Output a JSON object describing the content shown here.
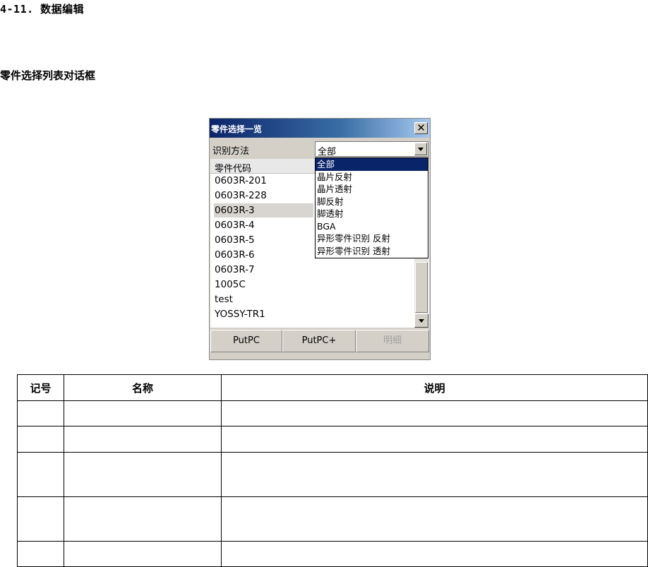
{
  "doc": {
    "heading": "4-11. 数据编辑",
    "subheading": "零件选择列表对话框"
  },
  "dialog": {
    "title": "零件选择一览",
    "close_glyph": "✕",
    "method_label": "识别方法",
    "method_selected": "全部",
    "list_header": "零件代码",
    "parts": [
      "0603R-201",
      "0603R-228",
      "0603R-3",
      "0603R-4",
      "0603R-5",
      "0603R-6",
      "0603R-7",
      "1005C",
      "test",
      "YOSSY-TR1"
    ],
    "selected_part": "0603R-3",
    "method_options": [
      "全部",
      "晶片反射",
      "晶片透射",
      "脚反射",
      "脚透射",
      "BGA",
      "异形零件识别 反射",
      "异形零件识别 透射"
    ],
    "buttons": {
      "putpc": "PutPC",
      "putpc_plus": "PutPC+",
      "detail": "明细"
    },
    "colors": {
      "title_bar": "#0a246a",
      "highlight": "#0a246a",
      "face": "#d4d0c8"
    }
  },
  "table": {
    "headers": [
      "记号",
      "名称",
      "说明"
    ],
    "rows": [
      {
        "mark": "",
        "name": "",
        "desc": ""
      },
      {
        "mark": "",
        "name": "",
        "desc": ""
      },
      {
        "mark": "",
        "name": "",
        "desc": ""
      },
      {
        "mark": "",
        "name": "",
        "desc": ""
      },
      {
        "mark": "",
        "name": "",
        "desc": ""
      }
    ]
  }
}
